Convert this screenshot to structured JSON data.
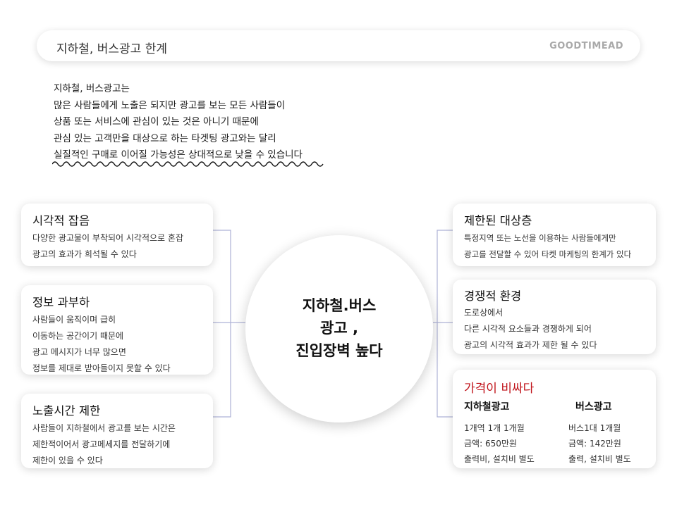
{
  "header": {
    "title": "지하철, 버스광고 한계",
    "brand": "GOODTIMEAD"
  },
  "intro": {
    "lines": [
      "지하철, 버스광고는",
      "많은 사람들에게 노출은 되지만 광고를 보는 모든 사람들이",
      "상품 또는 서비스에 관심이 있는 것은 아니기 때문에",
      "관심 있는 고객만을 대상으로 하는 타겟팅 광고와는 달리",
      "실질적인 구매로 이어질 가능성은 상대적으로 낮을 수 있습니다"
    ]
  },
  "center": {
    "lines": [
      "지하철.버스",
      "광고 ,",
      "진입장벽 높다"
    ]
  },
  "left_cards": [
    {
      "title": "시각적 잡음",
      "lines": [
        "다양한 광고물이 부착되어 시각적으로 혼잡",
        "광고의 효과가 희석될 수 있다"
      ]
    },
    {
      "title": "정보 과부하",
      "lines": [
        "사람들이 움직이며 급히",
        "이동하는 공간이기 때문에",
        "광고 메시지가 너무 많으면",
        "정보를 제대로 받아들이지 못할 수 있다"
      ]
    },
    {
      "title": "노출시간 제한",
      "lines": [
        "사람들이 지하철에서 광고를 보는 시간은",
        "제한적이어서 광고메세지를 전달하기에",
        "제한이 있을 수 있다"
      ]
    }
  ],
  "right_cards": [
    {
      "title": "제한된 대상층",
      "lines": [
        "특정지역 또는 노선을 이용하는 사람들에게만",
        "광고를 전달할 수 있어 타켓 마케팅의 한계가 있다"
      ]
    },
    {
      "title": "경쟁적 환경",
      "lines": [
        "도로상에서",
        "다른 시각적 요소들과 경쟁하게 되어",
        "광고의 시각적 효과가 제한 될 수 있다"
      ]
    }
  ],
  "price_card": {
    "title": "가격이 비싸다",
    "subway": {
      "title": "지하철광고",
      "lines": [
        "1개역 1개  1개월",
        "금액: 650만원",
        "출력비, 설치비 별도"
      ]
    },
    "bus": {
      "title": "버스광고",
      "lines": [
        "버스1대 1개월",
        "금액: 142만원",
        "출력, 설치비 별도"
      ]
    }
  },
  "colors": {
    "accent_red": "#c0141b",
    "connector": "#aeb2d6",
    "brand_gray": "#a9a9a9"
  }
}
